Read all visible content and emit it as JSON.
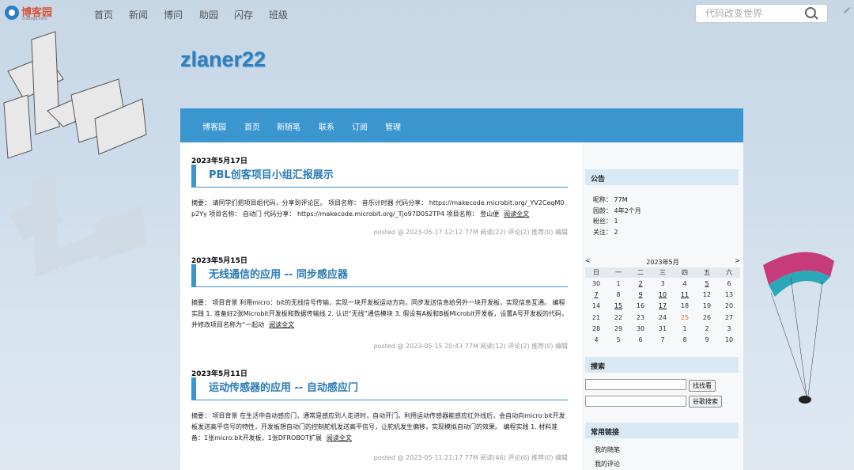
{
  "topnav": {
    "logo_text": "博客园",
    "logo_sub": "cnblogs.com",
    "links": [
      "首页",
      "新闻",
      "博问",
      "助园",
      "闪存",
      "班级"
    ],
    "search_placeholder": "代码改变世界"
  },
  "blog": {
    "title": "zlaner22"
  },
  "bluenav": [
    "博客园",
    "首页",
    "新随笔",
    "联系",
    "订阅",
    "管理"
  ],
  "posts": [
    {
      "date": "2023年5月17日",
      "title": "PBL创客项目小组汇报展示",
      "summary": "摘要：  请同学们把项目组代码，分享到评论区。 项目名称： 音乐计时器 代码分享： https://makecode.microbit.org/_YV2CeqM0p2Yy 项目名称： 自动门 代码分享： https://makecode.microbit.org/_Tjo97D052TP4 项目名称： 登山便",
      "more": "阅读全文",
      "meta": "posted @ 2023-05-17 12:12 77M 阅读(22) 评论(2) 推荐(0) 编辑"
    },
    {
      "date": "2023年5月15日",
      "title": "无线通信的应用 -- 同步感应器",
      "summary": "摘要：  项目背景 利用micro：bit的无线信号传输，实现一块开发板运动方向，同步发送信息给另外一块开发板，实现信息互通。 编程实践 1. 准备好2张Microbit开发板和数据传输线 2. 认识“无线”通信模块 3. 假设有A板和B板Microbit开发板，设置A号开发板的代码，并修改项目名称为“一起动",
      "more": "阅读全文",
      "meta": "posted @ 2023-05-15 20:43 77M 阅读(12) 评论(2) 推荐(0) 编辑"
    },
    {
      "date": "2023年5月11日",
      "title": "运动传感器的应用 -- 自动感应门",
      "summary": "摘要：  项目背景 在生活中自动感应门，通常是感应到人走进时，自动开门。利用运动传感器能感应红外线后，会自动向micro:bit开发板发送高平信号的特性，开发板想自动门的控制舵机发送高平信号，让舵机发生偏移，实现模拟自动门的效果。 编程实践 1. 材料准备：1张micro:bit开发板，1张DFROBOT扩展",
      "more": "阅读全文",
      "meta": "posted @ 2023-05-11 21:17 77M 阅读(46) 评论(6) 推荐(0) 编辑"
    }
  ],
  "sidebar": {
    "notice_title": "公告",
    "profile": {
      "nickname": "昵称： 77M",
      "age": "园龄： 4年2个月",
      "fans": "粉丝： 1",
      "follow": "关注： 2"
    },
    "calendar": {
      "prev": "<",
      "next": ">",
      "month": "2023年5月",
      "weekdays": [
        "日",
        "一",
        "二",
        "三",
        "四",
        "五",
        "六"
      ],
      "weeks": [
        [
          "30",
          "1",
          "2",
          "3",
          "4",
          "5",
          "6"
        ],
        [
          "7",
          "8",
          "9",
          "10",
          "11",
          "12",
          "13"
        ],
        [
          "14",
          "15",
          "16",
          "17",
          "18",
          "19",
          "20"
        ],
        [
          "21",
          "22",
          "23",
          "24",
          "25",
          "26",
          "27"
        ],
        [
          "28",
          "29",
          "30",
          "31",
          "1",
          "2",
          "3"
        ],
        [
          "4",
          "5",
          "6",
          "7",
          "8",
          "9",
          "10"
        ]
      ],
      "linked_days": [
        "0-2",
        "0-5",
        "1-0",
        "1-2",
        "1-3",
        "1-4",
        "2-1",
        "2-3"
      ],
      "today": "3-4"
    },
    "search_title": "搜索",
    "search_btn": "找找看",
    "google_btn": "谷歌搜索",
    "links_title": "常用链接",
    "links": [
      "我的随笔",
      "我的评论"
    ]
  },
  "colors": {
    "accent": "#3b95cf",
    "title": "#2f7fbf",
    "today": "#e0702c"
  }
}
